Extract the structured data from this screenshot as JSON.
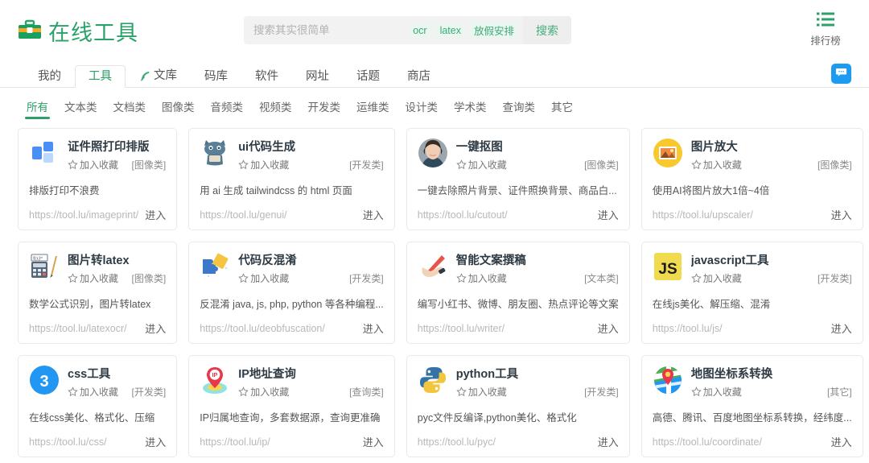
{
  "header": {
    "logo_text": "在线工具",
    "logo_icon": "toolbox-icon",
    "search": {
      "placeholder": "搜索其实很简单",
      "value": "",
      "hot_tags": [
        "ocr",
        "latex",
        "放假安排"
      ],
      "button_label": "搜索"
    },
    "rank": {
      "icon": "ranking-list-icon",
      "label": "排行榜"
    }
  },
  "tabs": [
    {
      "label": "我的",
      "active": false,
      "icon": null
    },
    {
      "label": "工具",
      "active": true,
      "icon": null
    },
    {
      "label": "文库",
      "active": false,
      "icon": "feather-pen-icon"
    },
    {
      "label": "码库",
      "active": false,
      "icon": null
    },
    {
      "label": "软件",
      "active": false,
      "icon": null
    },
    {
      "label": "网址",
      "active": false,
      "icon": null
    },
    {
      "label": "话题",
      "active": false,
      "icon": null
    },
    {
      "label": "商店",
      "active": false,
      "icon": null
    }
  ],
  "chat_button": {
    "icon": "chat-bubble-icon"
  },
  "categories": [
    {
      "label": "所有",
      "active": true
    },
    {
      "label": "文本类",
      "active": false
    },
    {
      "label": "文档类",
      "active": false
    },
    {
      "label": "图像类",
      "active": false
    },
    {
      "label": "音频类",
      "active": false
    },
    {
      "label": "视频类",
      "active": false
    },
    {
      "label": "开发类",
      "active": false
    },
    {
      "label": "运维类",
      "active": false
    },
    {
      "label": "设计类",
      "active": false
    },
    {
      "label": "学术类",
      "active": false
    },
    {
      "label": "查询类",
      "active": false
    },
    {
      "label": "其它",
      "active": false
    }
  ],
  "card_common": {
    "fav_label": "加入收藏",
    "fav_icon": "star-outline-icon",
    "enter_label": "进入"
  },
  "cards": [
    {
      "title": "证件照打印排版",
      "category": "[图像类]",
      "desc": "排版打印不浪费",
      "url": "https://tool.lu/imageprint/",
      "icon": "photo-layout-icon",
      "icon_color": "#4a90f4"
    },
    {
      "title": "ui代码生成",
      "category": "[开发类]",
      "desc": "用 ai 生成 tailwindcss 的 html 页面",
      "url": "https://tool.lu/genui/",
      "icon": "cat-mascot-icon",
      "icon_color": "#52718a"
    },
    {
      "title": "一键抠图",
      "category": "[图像类]",
      "desc": "一键去除照片背景、证件照换背景、商品白...",
      "url": "https://tool.lu/cutout/",
      "icon": "portrait-photo-icon",
      "icon_color": "#6a5a52"
    },
    {
      "title": "图片放大",
      "category": "[图像类]",
      "desc": "使用AI将图片放大1倍~4倍",
      "url": "https://tool.lu/upscaler/",
      "icon": "image-upscale-icon",
      "icon_color": "#f7c92e"
    },
    {
      "title": "图片转latex",
      "category": "[图像类]",
      "desc": "数学公式识别，图片转latex",
      "url": "https://tool.lu/latexocr/",
      "icon": "calculator-formula-icon",
      "icon_color": "#4f6070"
    },
    {
      "title": "代码反混淆",
      "category": "[开发类]",
      "desc": "反混淆 java, js, php, python 等各种编程...",
      "url": "https://tool.lu/deobfuscation/",
      "icon": "puzzle-pieces-icon",
      "icon_color": "#3d79c8"
    },
    {
      "title": "智能文案撰稿",
      "category": "[文本类]",
      "desc": "编写小红书、微博、朋友圈、热点评论等文案",
      "url": "https://tool.lu/writer/",
      "icon": "hand-writing-pen-icon",
      "icon_color": "#e8544a"
    },
    {
      "title": "javascript工具",
      "category": "[开发类]",
      "desc": "在线js美化、解压缩、混淆",
      "url": "https://tool.lu/js/",
      "icon": "js-logo-icon",
      "icon_color": "#f0db4f"
    },
    {
      "title": "css工具",
      "category": "[开发类]",
      "desc": "在线css美化、格式化、压缩",
      "url": "https://tool.lu/css/",
      "icon": "css3-logo-icon",
      "icon_color": "#2196f3"
    },
    {
      "title": "IP地址查询",
      "category": "[查询类]",
      "desc": "IP归属地查询，多套数据源，查询更准确",
      "url": "https://tool.lu/ip/",
      "icon": "map-pin-ip-icon",
      "icon_color": "#e8374a"
    },
    {
      "title": "python工具",
      "category": "[开发类]",
      "desc": "pyc文件反编译,python美化、格式化",
      "url": "https://tool.lu/pyc/",
      "icon": "python-logo-icon",
      "icon_color": "#3572a5"
    },
    {
      "title": "地图坐标系转换",
      "category": "[其它]",
      "desc": "高德、腾讯、百度地图坐标系转换，经纬度...",
      "url": "https://tool.lu/coordinate/",
      "icon": "map-location-icon",
      "icon_color": "#3fa95f"
    }
  ],
  "colors": {
    "brand_green": "#2aa26a",
    "tag_green": "#3cab78",
    "link_grey": "#b8b8b8",
    "chat_blue": "#1d9bf0"
  }
}
